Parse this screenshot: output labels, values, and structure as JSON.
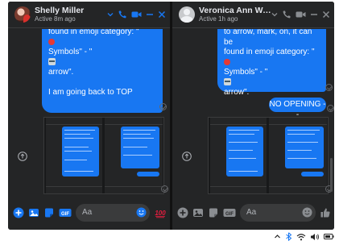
{
  "left_chat": {
    "contact_name": "Shelly Miller",
    "status": "Active 8m ago",
    "message_lines": [
      "found in emoji category: \"",
      "",
      "Symbols\" - \"",
      "",
      "arrow\".",
      "",
      "I am going back to TOP"
    ],
    "input_placeholder": "Aa"
  },
  "right_chat": {
    "contact_name": "Veronica Ann Warn...",
    "status": "Active 1h ago",
    "message_lines": [
      "to arrow, mark, on, it can be",
      "found in emoji category: \"",
      "",
      "Symbols\" - \"",
      "",
      "arrow\"."
    ],
    "reply": "NO OPENING --",
    "input_placeholder": "Aa"
  },
  "colors": {
    "messenger_blue": "#1877f2",
    "panel_bg": "#242526",
    "dark_bg": "#18191a",
    "accent_red": "#e53935",
    "like_red": "#e41e3f"
  },
  "icons": [
    "chevron-down-icon",
    "phone-icon",
    "video-icon",
    "minimize-icon",
    "close-icon",
    "share-icon",
    "plus-icon",
    "photo-icon",
    "sticker-icon",
    "gif-icon",
    "emoji-icon",
    "thumbs-up-icon",
    "chevron-up-icon",
    "bluetooth-icon",
    "wifi-icon",
    "volume-icon",
    "battery-icon"
  ]
}
